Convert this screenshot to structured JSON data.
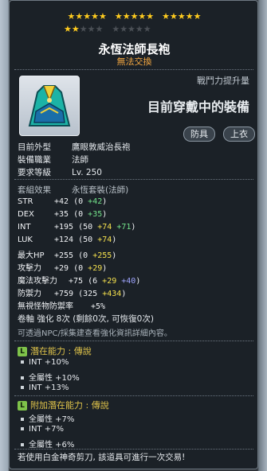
{
  "stars": {
    "row1": "★★★★★  ★★★★★  ★★★★★",
    "filled_total": 17,
    "max_total": 25
  },
  "item": {
    "name": "永恆法師長袍",
    "trade_note": "無法交換",
    "combat_label": "戰鬥力提升量",
    "combat_value": "目前穿戴中的裝備",
    "tags": [
      "防具",
      "上衣"
    ],
    "icon": "mage-robe-icon"
  },
  "info": {
    "appearance_label": "目前外型",
    "appearance_value": "鷹眼敦威治長袍",
    "job_label": "裝備職業",
    "job_value": "法師",
    "level_label": "要求等級",
    "level_value": "Lv. 250"
  },
  "set": {
    "label": "套組效果",
    "value": "永恆套裝(法師)"
  },
  "stats": [
    {
      "name": "STR",
      "total": "+42",
      "base": "0",
      "bonus": "+42",
      "scroll": "",
      "star": ""
    },
    {
      "name": "DEX",
      "total": "+35",
      "base": "0",
      "bonus": "+35",
      "scroll": "",
      "star": ""
    },
    {
      "name": "INT",
      "total": "+195",
      "base": "50",
      "bonus": "+74",
      "scroll": "",
      "star": "+71"
    },
    {
      "name": "LUK",
      "total": "+124",
      "base": "50",
      "bonus": "",
      "scroll": "",
      "star": "+74"
    },
    {
      "name": "最大HP",
      "total": "+255",
      "base": "0",
      "bonus": "",
      "scroll": "",
      "star": "+255"
    },
    {
      "name": "攻擊力",
      "total": "+29",
      "base": "0",
      "bonus": "",
      "scroll": "",
      "star": "+29"
    },
    {
      "name": "魔法攻擊力",
      "total": "+75",
      "base": "6",
      "bonus": "",
      "scroll": "+29",
      "star": "+40"
    },
    {
      "name": "防禦力",
      "total": "+759",
      "base": "325",
      "bonus": "",
      "scroll": "",
      "star": "+434"
    },
    {
      "name": "無視怪物防禦率",
      "total": "+5%",
      "base": "",
      "bonus": "",
      "scroll": "",
      "star": ""
    }
  ],
  "upgrade_line": "卷軸 強化 8次 (剩餘0次, 可恢復0次)",
  "npc_note": "可透過NPC/採集建查看強化資訊詳細內容。",
  "potential": {
    "title": "潛在能力 : 傳說",
    "lines": [
      "INT +10%",
      "全屬性 +10%",
      "INT +13%"
    ]
  },
  "additional": {
    "title": "附加潛在能力 : 傳說",
    "lines": [
      "全屬性 +7%",
      "INT +7%",
      "全屬性 +6%"
    ]
  },
  "footer": "若使用白金神奇剪刀, 該道具可進行一次交易!",
  "colors": {
    "gold": "#ffcc1f",
    "green": "#73e28a",
    "yellow": "#f4e04d",
    "purple": "#9fa5ff",
    "orange": "#f2a640",
    "badge": "#7ec24a"
  }
}
